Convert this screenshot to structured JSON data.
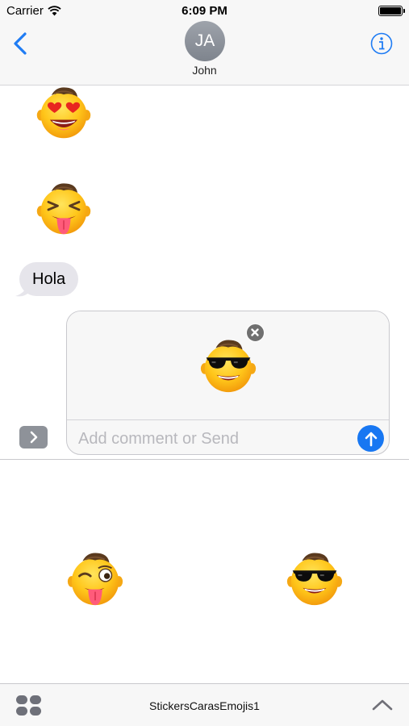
{
  "status_bar": {
    "carrier": "Carrier",
    "time": "6:09 PM"
  },
  "header": {
    "avatar_initials": "JA",
    "contact_name": "John"
  },
  "conversation": {
    "messages": [
      {
        "type": "sticker",
        "sticker": "heart-eyes-face"
      },
      {
        "type": "sticker",
        "sticker": "tongue-out-squint-face"
      },
      {
        "type": "text",
        "text": "Hola"
      }
    ]
  },
  "compose": {
    "attached_sticker": "sunglasses-face",
    "comment_value": "",
    "comment_placeholder": "Add comment or Send"
  },
  "drawer": {
    "stickers": [
      "wink-tongue-face",
      "sunglasses-face"
    ]
  },
  "bottom_bar": {
    "app_name": "StickersCarasEmojis1"
  },
  "colors": {
    "accent": "#1877f2",
    "bubble": "#e6e5eb",
    "face": "#ffc61a",
    "hair": "#5a3a1e"
  },
  "icons": [
    "wifi-icon",
    "battery-icon",
    "back-chevron-icon",
    "info-icon",
    "expand-chevron-icon",
    "close-icon",
    "send-arrow-icon",
    "app-drawer-icon",
    "chevron-up-icon"
  ]
}
